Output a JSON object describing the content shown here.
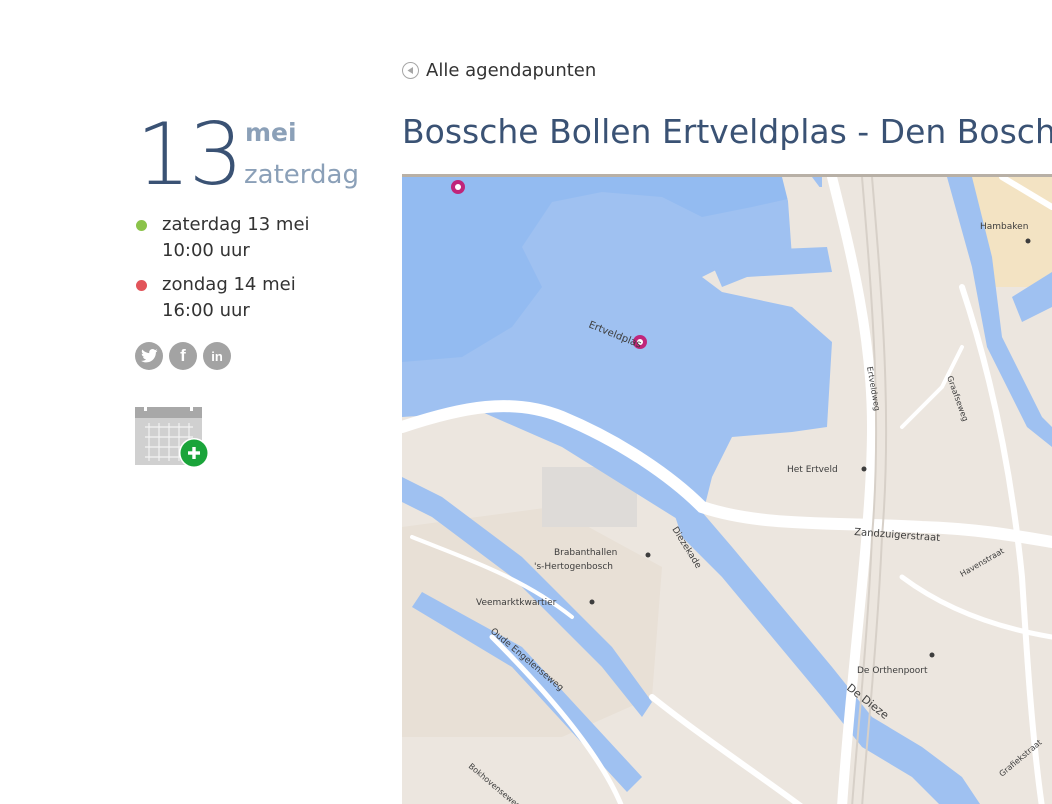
{
  "nav": {
    "back_label": "Alle agendapunten",
    "back_icon": "arrow-left-circle-icon"
  },
  "date": {
    "day": "13",
    "month": "mei",
    "weekday": "zaterdag"
  },
  "schedule": [
    {
      "status_color": "#8bc34a",
      "date": "zaterdag 13 mei",
      "time": "10:00 uur"
    },
    {
      "status_color": "#e2545a",
      "date": "zondag 14 mei",
      "time": "16:00 uur"
    }
  ],
  "social": [
    {
      "icon": "twitter-icon"
    },
    {
      "icon": "facebook-icon",
      "glyph": "f"
    },
    {
      "icon": "linkedin-icon",
      "glyph": "in"
    }
  ],
  "calendar_add": {
    "icon": "calendar-add-icon"
  },
  "event": {
    "title": "Bossche Bollen Ertveldplas - Den Bosch Ran"
  },
  "map": {
    "labels": {
      "ertveldplas": "Ertveldplas",
      "hambaken": "Hambaken",
      "het_ertveld": "Het Ertveld",
      "zandzuigerstraat": "Zandzuigerstraat",
      "brabanthallen": "Brabanthallen",
      "hertogenbosch": "'s-Hertogenbosch",
      "veemarkt": "Veemarktkwartier",
      "dieze": "De Dieze",
      "orthenpoort": "De Orthenpoort",
      "diezekade": "Diezekade",
      "ertveldweg": "Ertveldweg",
      "oude_engelenseweg": "Oude Engelenseweg",
      "graafseweg": "Graafseweg",
      "havenstraat": "Havenstraat",
      "bokhovenseweg": "Bokhovenseweg",
      "grafiek": "Grafiekstraat"
    }
  }
}
